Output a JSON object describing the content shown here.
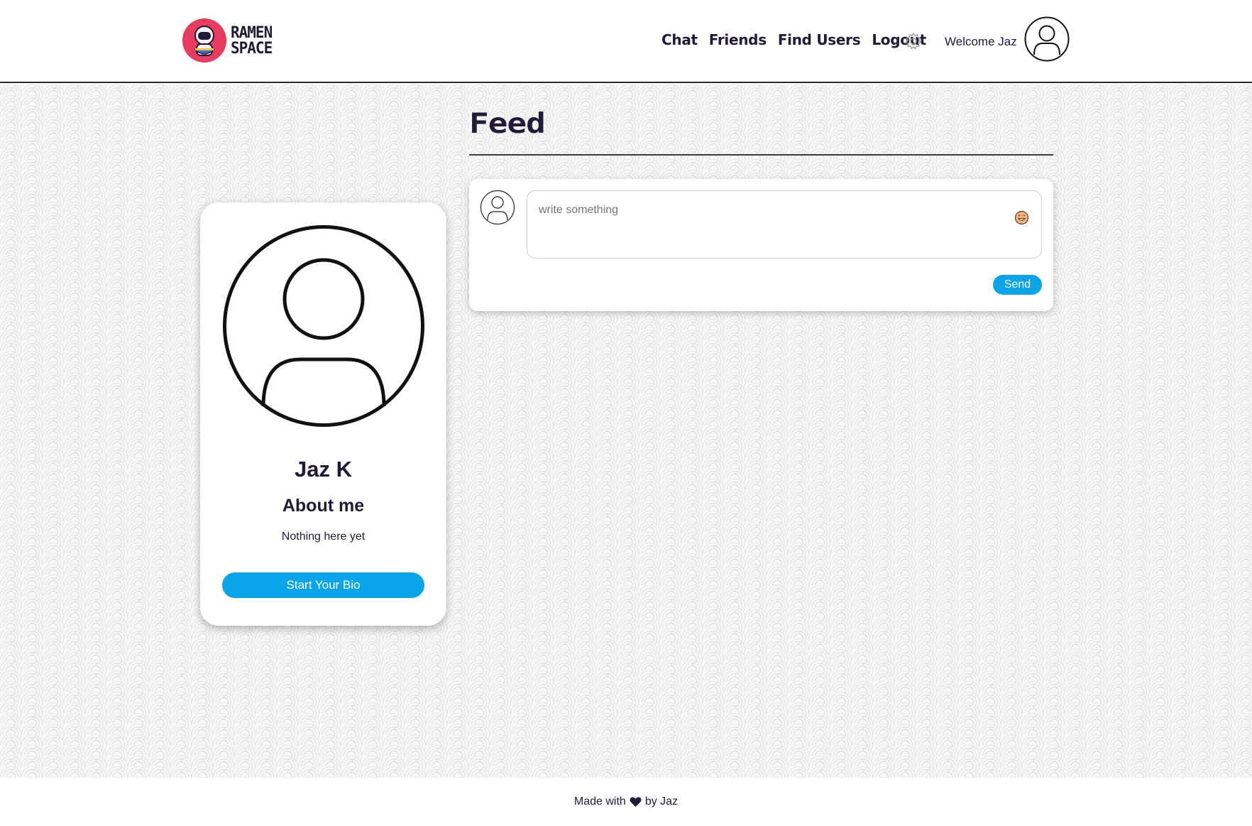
{
  "brand": {
    "line1": "RAMEN",
    "line2": "SPACE",
    "logo_color": "#e83b5f"
  },
  "nav": {
    "items": [
      "Chat",
      "Friends",
      "Find Users",
      "Logout"
    ],
    "settings_icon": "gear-icon"
  },
  "user": {
    "welcome": "Welcome Jaz",
    "avatar_icon": "user-circle-icon"
  },
  "profile": {
    "name": "Jaz K",
    "about_title": "About me",
    "about_text": "Nothing here yet",
    "bio_button": "Start Your Bio"
  },
  "feed": {
    "title": "Feed",
    "composer": {
      "placeholder": "write something",
      "value": "",
      "emoji_icon": "smiley-icon",
      "send_label": "Send"
    }
  },
  "footer": {
    "made_with": "Made with",
    "by": "by Jaz",
    "heart_icon": "heart-icon"
  },
  "colors": {
    "accent": "#0aa5e8",
    "text": "#231a3a",
    "brand_red": "#e83b5f"
  }
}
